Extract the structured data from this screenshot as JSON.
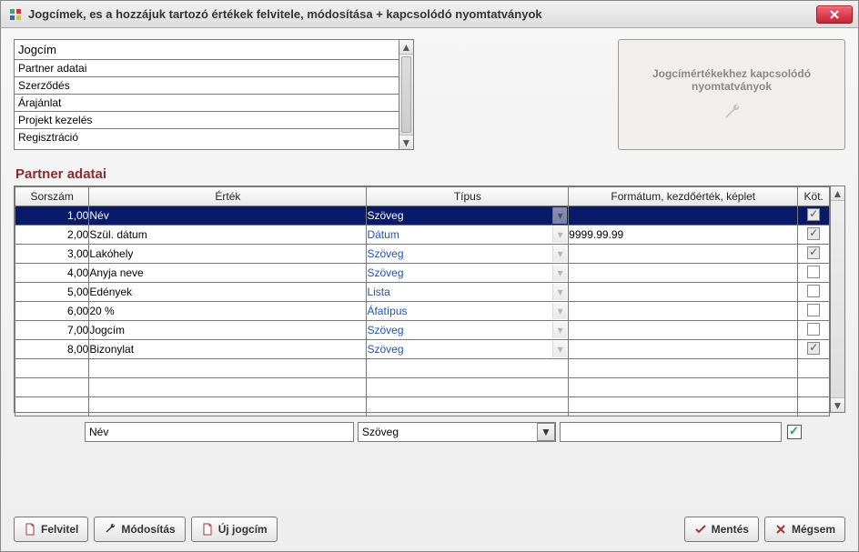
{
  "window": {
    "title": "Jogcímek, es a hozzájuk tartozó értékek felvitele, módosítása + kapcsolódó nyomtatványok"
  },
  "listbox": {
    "header": "Jogcím",
    "items": [
      "Partner adatai",
      "Szerződés",
      "Árajánlat",
      "Projekt kezelés",
      "Regisztráció"
    ]
  },
  "side_panel": {
    "line1": "Jogcímértékekhez kapcsolódó",
    "line2": "nyomtatványok"
  },
  "section_title": "Partner adatai",
  "grid": {
    "headers": {
      "num": "Sorszám",
      "val": "Érték",
      "type": "Típus",
      "fmt": "Formátum, kezdőérték, képlet",
      "chk": "Köt."
    },
    "rows": [
      {
        "num": "1,00",
        "val": "Név",
        "type": "Szöveg",
        "fmt": "",
        "chk": true,
        "selected": true
      },
      {
        "num": "2,00",
        "val": "Szül. dátum",
        "type": "Dátum",
        "fmt": "9999.99.99",
        "chk": true
      },
      {
        "num": "3,00",
        "val": "Lakóhely",
        "type": "Szöveg",
        "fmt": "",
        "chk": true
      },
      {
        "num": "4,00",
        "val": "Anyja neve",
        "type": "Szöveg",
        "fmt": "",
        "chk": false
      },
      {
        "num": "5,00",
        "val": "Edények",
        "type": "Lista",
        "fmt": "",
        "chk": false
      },
      {
        "num": "6,00",
        "val": "20 %",
        "type": "Áfatípus",
        "fmt": "",
        "chk": false
      },
      {
        "num": "7,00",
        "val": "Jogcím",
        "type": "Szöveg",
        "fmt": "",
        "chk": false
      },
      {
        "num": "8,00",
        "val": "Bizonylat",
        "type": "Szöveg",
        "fmt": "",
        "chk": true
      }
    ],
    "empty_rows": 3
  },
  "editor": {
    "val": "Név",
    "type": "Szöveg",
    "fmt": "",
    "chk": true
  },
  "buttons": {
    "felvitel": "Felvitel",
    "modositas": "Módosítás",
    "uj_jogcim": "Új jogcím",
    "mentes": "Mentés",
    "megsem": "Mégsem"
  }
}
